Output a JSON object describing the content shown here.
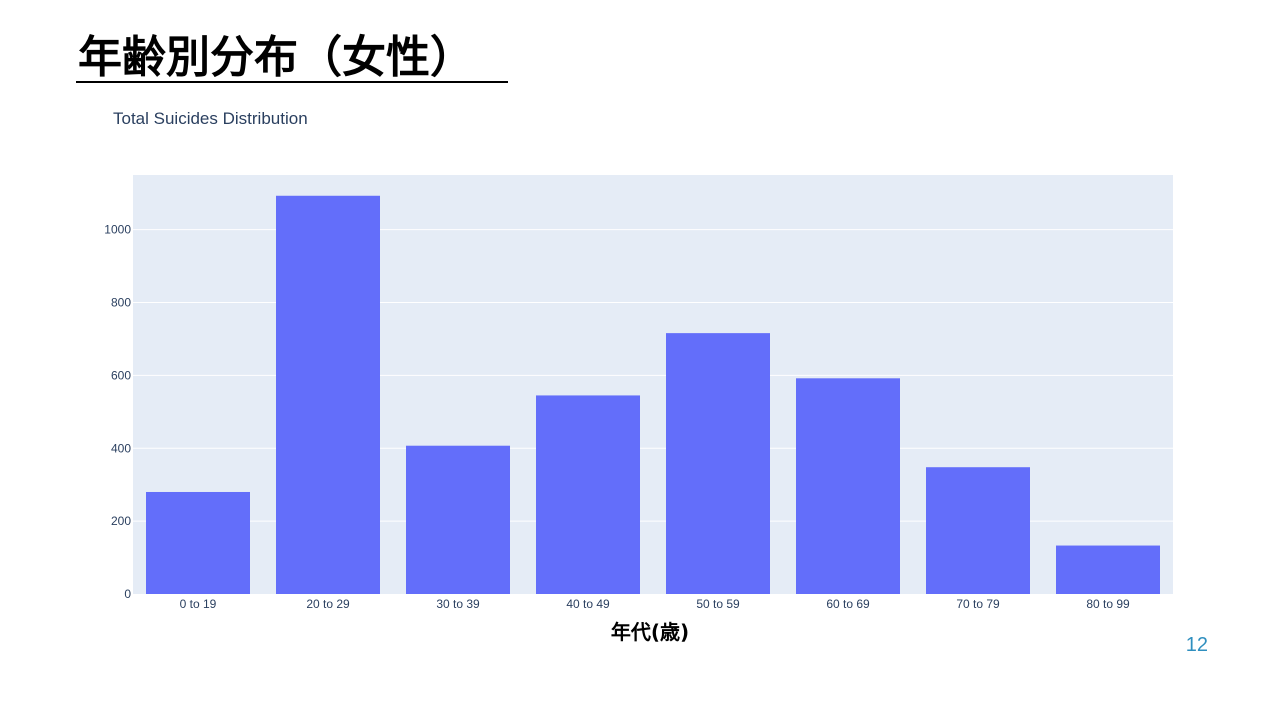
{
  "slide": {
    "title": "年齢別分布（女性）",
    "page_number": "12"
  },
  "colors": {
    "bar": "#636efa",
    "plot_bg": "#e5ecf6",
    "grid": "#ffffff",
    "tick_text": "#2a3f5f",
    "page_number": "#2f8fbf"
  },
  "chart_data": {
    "type": "bar",
    "title": "Total Suicides Distribution",
    "xlabel": "年代(歳)",
    "ylabel": "",
    "categories": [
      "0 to 19",
      "20 to 29",
      "30 to 39",
      "40 to 49",
      "50 to 59",
      "60 to 69",
      "70 to 79",
      "80 to 99"
    ],
    "values": [
      280,
      1093,
      407,
      545,
      716,
      592,
      348,
      133
    ],
    "ylim": [
      0,
      1150
    ],
    "yticks": [
      0,
      200,
      400,
      600,
      800,
      1000
    ],
    "grid": true,
    "legend": "none"
  }
}
